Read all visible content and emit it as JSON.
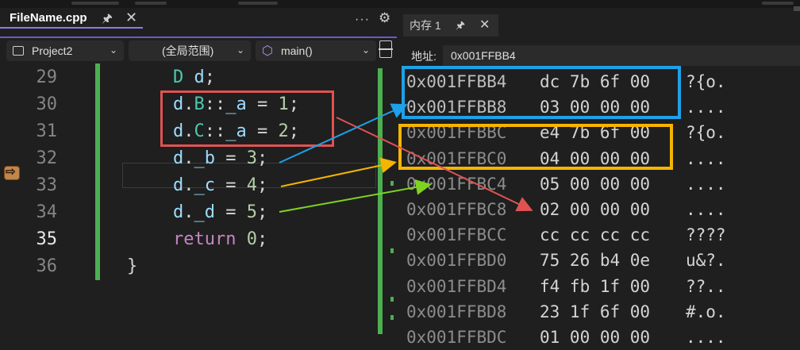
{
  "editor": {
    "tab_title": "FileName.cpp",
    "project": "Project2",
    "scope": "(全局范围)",
    "function": "main()",
    "lines": [
      {
        "num": "29",
        "tokens": [
          {
            "t": "D ",
            "c": "k-type"
          },
          {
            "t": "d",
            "c": "k-var"
          },
          {
            "t": ";",
            "c": ""
          }
        ]
      },
      {
        "num": "30",
        "tokens": [
          {
            "t": "d",
            "c": "k-var"
          },
          {
            "t": ".",
            "c": ""
          },
          {
            "t": "B",
            "c": "k-type"
          },
          {
            "t": "::",
            "c": ""
          },
          {
            "t": "_a",
            "c": "k-var"
          },
          {
            "t": " = ",
            "c": ""
          },
          {
            "t": "1",
            "c": "k-num"
          },
          {
            "t": ";",
            "c": ""
          }
        ]
      },
      {
        "num": "31",
        "tokens": [
          {
            "t": "d",
            "c": "k-var"
          },
          {
            "t": ".",
            "c": ""
          },
          {
            "t": "C",
            "c": "k-type"
          },
          {
            "t": "::",
            "c": ""
          },
          {
            "t": "_a",
            "c": "k-var"
          },
          {
            "t": " = ",
            "c": ""
          },
          {
            "t": "2",
            "c": "k-num"
          },
          {
            "t": ";",
            "c": ""
          }
        ]
      },
      {
        "num": "32",
        "tokens": [
          {
            "t": "d",
            "c": "k-var"
          },
          {
            "t": ".",
            "c": ""
          },
          {
            "t": "_b",
            "c": "k-var"
          },
          {
            "t": " = ",
            "c": ""
          },
          {
            "t": "3",
            "c": "k-num"
          },
          {
            "t": ";",
            "c": ""
          }
        ]
      },
      {
        "num": "33",
        "tokens": [
          {
            "t": "d",
            "c": "k-var"
          },
          {
            "t": ".",
            "c": ""
          },
          {
            "t": "_c",
            "c": "k-var"
          },
          {
            "t": " = ",
            "c": ""
          },
          {
            "t": "4",
            "c": "k-num"
          },
          {
            "t": ";",
            "c": ""
          }
        ]
      },
      {
        "num": "34",
        "tokens": [
          {
            "t": "d",
            "c": "k-var"
          },
          {
            "t": ".",
            "c": ""
          },
          {
            "t": "_d",
            "c": "k-var"
          },
          {
            "t": " = ",
            "c": ""
          },
          {
            "t": "5",
            "c": "k-num"
          },
          {
            "t": ";",
            "c": ""
          }
        ]
      },
      {
        "num": "35",
        "tokens": [
          {
            "t": "return",
            "c": "k-kw"
          },
          {
            "t": " ",
            "c": ""
          },
          {
            "t": "0",
            "c": "k-num"
          },
          {
            "t": ";",
            "c": ""
          }
        ]
      },
      {
        "num": "36",
        "tokens": [
          {
            "t": "}",
            "c": ""
          }
        ]
      }
    ]
  },
  "memory": {
    "tab_title": "内存 1",
    "address_label": "地址:",
    "address_value": "0x001FFBB4",
    "rows": [
      {
        "addr": "0x001FFBB4",
        "bytes": "dc 7b 6f 00",
        "ascii": "?{o."
      },
      {
        "addr": "0x001FFBB8",
        "bytes": "03 00 00 00",
        "ascii": "...."
      },
      {
        "addr": "0x001FFBBC",
        "bytes": "e4 7b 6f 00",
        "ascii": "?{o."
      },
      {
        "addr": "0x001FFBC0",
        "bytes": "04 00 00 00",
        "ascii": "...."
      },
      {
        "addr": "0x001FFBC4",
        "bytes": "05 00 00 00",
        "ascii": "...."
      },
      {
        "addr": "0x001FFBC8",
        "bytes": "02 00 00 00",
        "ascii": "...."
      },
      {
        "addr": "0x001FFBCC",
        "bytes": "cc cc cc cc",
        "ascii": "????"
      },
      {
        "addr": "0x001FFBD0",
        "bytes": "75 26 b4 0e",
        "ascii": "u&?."
      },
      {
        "addr": "0x001FFBD4",
        "bytes": "f4 fb 1f 00",
        "ascii": "??.."
      },
      {
        "addr": "0x001FFBD8",
        "bytes": "23 1f 6f 00",
        "ascii": "#.o."
      },
      {
        "addr": "0x001FFBDC",
        "bytes": "01 00 00 00",
        "ascii": "...."
      }
    ]
  },
  "icons": {
    "pin": "pin-icon",
    "close": "close-icon",
    "more": "more-icon",
    "settings": "gear-icon",
    "cube": "cube-icon",
    "project": "project-icon",
    "split": "split-editor-icon",
    "breakpoint": "current-statement-arrow-icon"
  },
  "colors": {
    "annotation_red": "#e05252",
    "annotation_blue": "#1ea1e8",
    "annotation_orange": "#f4b400",
    "annotation_green": "#7ed321",
    "change_bar_green": "#4caf50"
  }
}
